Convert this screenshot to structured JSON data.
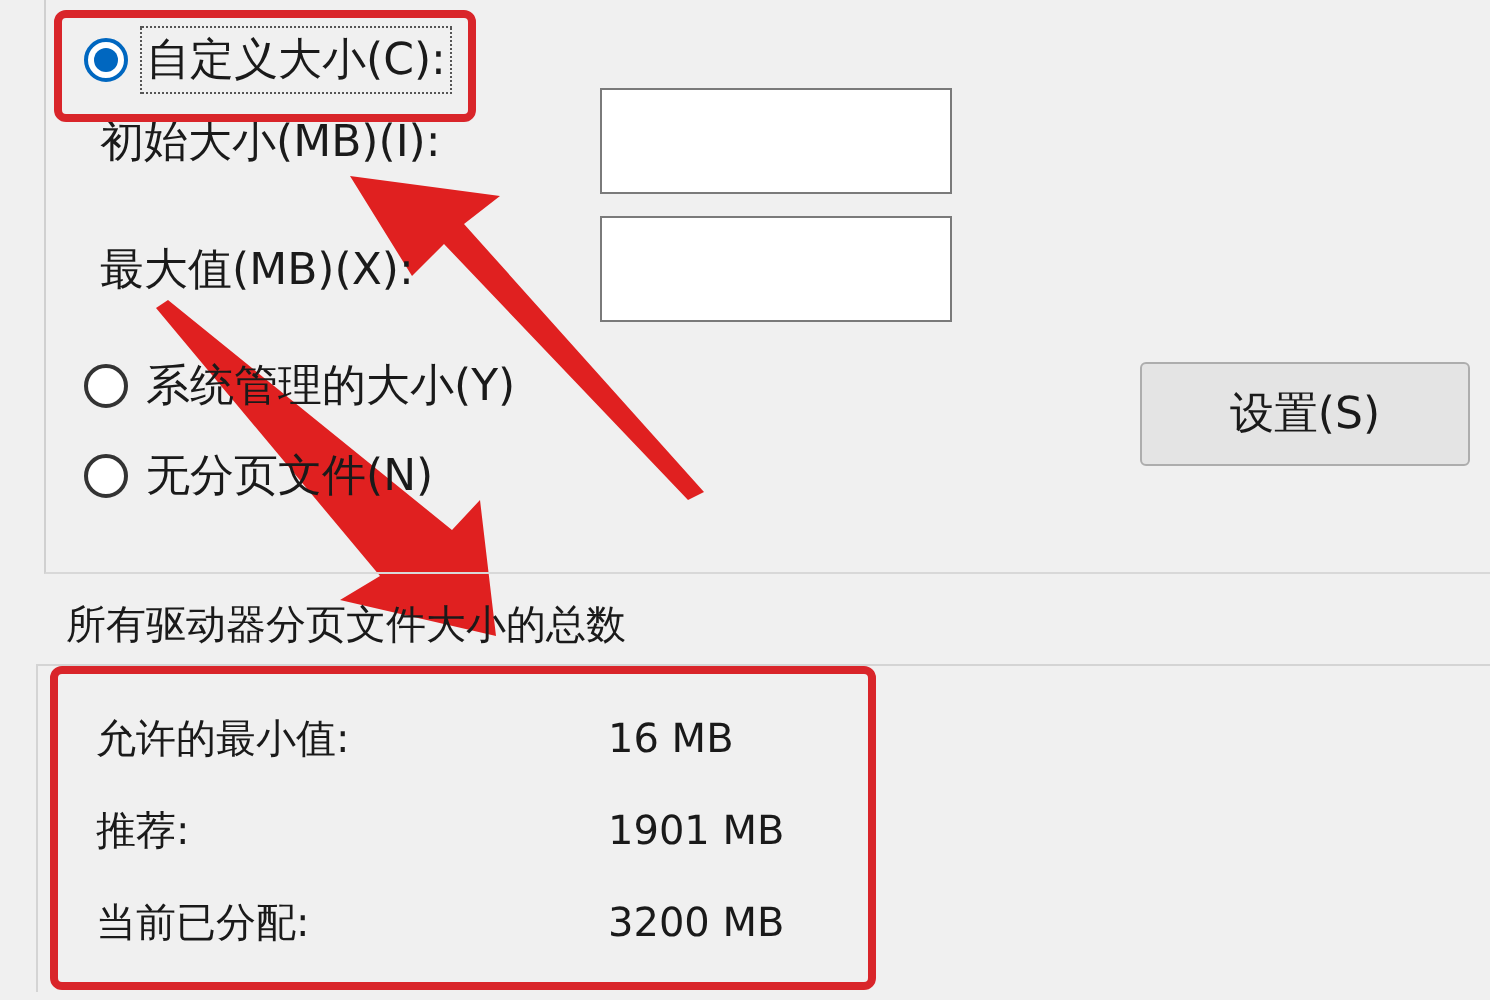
{
  "paging_options": [
    {
      "label": "自定义大小(C):",
      "selected": true,
      "focused": true
    },
    {
      "label": "系统管理的大小(Y)",
      "selected": false,
      "focused": false
    },
    {
      "label": "无分页文件(N)",
      "selected": false,
      "focused": false
    }
  ],
  "size_fields": [
    {
      "label": "初始大小(MB)(I):"
    },
    {
      "label": "最大值(MB)(X):"
    }
  ],
  "set_button": "设置(S)",
  "totals": {
    "title": "所有驱动器分页文件大小的总数",
    "rows": [
      {
        "label": "允许的最小值:",
        "value": "16 MB"
      },
      {
        "label": "推荐:",
        "value": "1901 MB"
      },
      {
        "label": "当前已分配:",
        "value": "3200 MB"
      }
    ]
  }
}
